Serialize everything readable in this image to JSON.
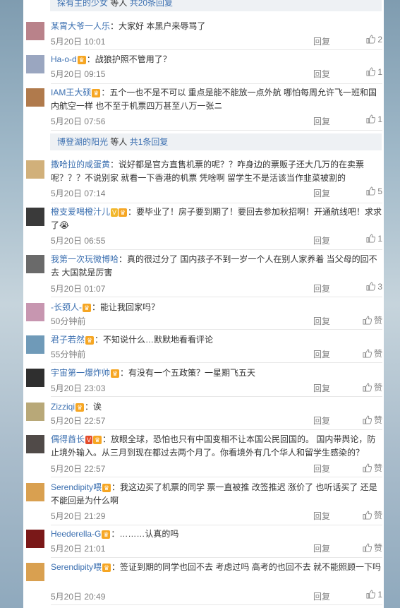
{
  "top_sub": {
    "name": "探有主的少女",
    "text": " 等人 ",
    "count": "共20条回复"
  },
  "comments": [
    {
      "user": "某霄大爷一人乐",
      "badges": [],
      "text": "：大家好 本黑户来辱骂了",
      "time": "5月20日 10:01",
      "reply": "回复",
      "likes": "2"
    },
    {
      "user": "Ha-o-d",
      "badges": [
        "vip"
      ],
      "text": "：战狼护照不管用了？",
      "time": "5月20日 09:15",
      "reply": "回复",
      "likes": "1"
    },
    {
      "user": "IAM王大硕",
      "badges": [
        "vip"
      ],
      "text": "：五个一也不是不可以 重点是能不能放一点外航 哪怕每周允许飞一班和国内航空一样 也不至于机票四万甚至八万一张ニ",
      "time": "5月20日 07:56",
      "reply": "回复",
      "likes": "1"
    },
    {
      "user": "撒哈拉的咸蛋黄",
      "badges": [],
      "text": "：说好都是官方直售机票的呢？？咋身边的票贩子还大几万的在卖票呢？？？不说别家 就看一下香港的机票 凭啥啊 留学生不是活该当作韭菜被割的",
      "time": "5月20日 07:14",
      "reply": "回复",
      "likes": "5"
    },
    {
      "user": "橙支爱喝橙汁儿",
      "badges": [
        "v",
        "vip"
      ],
      "text": "：要毕业了！房子要到期了！要回去参加秋招啊！开通航线吧！求求了😭",
      "time": "5月20日 06:55",
      "reply": "回复",
      "likes": "1"
    },
    {
      "user": "我第一次玩微博哈",
      "badges": [],
      "text": "：真的很过分了 国内孩子不到一岁一个人在别人家养着 当父母的回不去 大国就是厉害",
      "time": "5月20日 01:07",
      "reply": "回复",
      "likes": "3"
    },
    {
      "user": "-长颈人-",
      "badges": [
        "vip"
      ],
      "text": "：能让我回家吗？",
      "time": "50分钟前",
      "reply": "回复",
      "likes": "赞"
    },
    {
      "user": "君子若然",
      "badges": [
        "vip"
      ],
      "text": "：不知说什么…默默地看看评论",
      "time": "55分钟前",
      "reply": "回复",
      "likes": "赞"
    },
    {
      "user": "宇宙第一爆炸帅",
      "badges": [
        "vip"
      ],
      "text": "：有没有一个五政策？一星期飞五天",
      "time": "5月20日 23:03",
      "reply": "回复",
      "likes": "赞"
    },
    {
      "user": "Zizziqi",
      "badges": [
        "vip"
      ],
      "text": "：诶",
      "time": "5月20日 22:57",
      "reply": "回复",
      "likes": "赞"
    },
    {
      "user": "偶得酋长",
      "badges": [
        "vr",
        "vip"
      ],
      "text": "：放眼全球，恐怕也只有中国变相不让本国公民回国的。 国内带舆论，防止境外输入。从三月到现在都过去两个月了。你看境外有几个华人和留学生感染的？",
      "time": "5月20日 22:57",
      "reply": "回复",
      "likes": "赞"
    },
    {
      "user": "Serendipity喂",
      "badges": [
        "vip"
      ],
      "text": "：我这边买了机票的同学 票一直被推 改签推迟 涨价了 也听话买了 还是不能回是为什么啊",
      "time": "5月20日 21:29",
      "reply": "回复",
      "likes": "赞"
    },
    {
      "user": "Heederella-G",
      "badges": [
        "vip"
      ],
      "text": "：………认真的吗",
      "time": "5月20日 21:01",
      "reply": "回复",
      "likes": "赞"
    },
    {
      "user": "Serendipity喂",
      "badges": [
        "vip"
      ],
      "text": "：签证到期的同学也回不去 考虑过吗 高考的也回不去 就不能照顾一下吗",
      "time": "5月20日 20:49",
      "reply": "回复",
      "likes": "1"
    }
  ],
  "sub_more": {
    "name": "博登湖的阳光",
    "text": " 等人 ",
    "count": "共1条回复"
  },
  "avatar_colors": [
    "#b9828a",
    "#9aa6c0",
    "#b07a4c",
    "#d1b07a",
    "#3a3a3a",
    "#6a6a6a",
    "#c796b0",
    "#6f9ab8",
    "#2f2f2f",
    "#b8a878",
    "#504a48",
    "#d9a050",
    "#7a1818",
    "#d9a050"
  ]
}
